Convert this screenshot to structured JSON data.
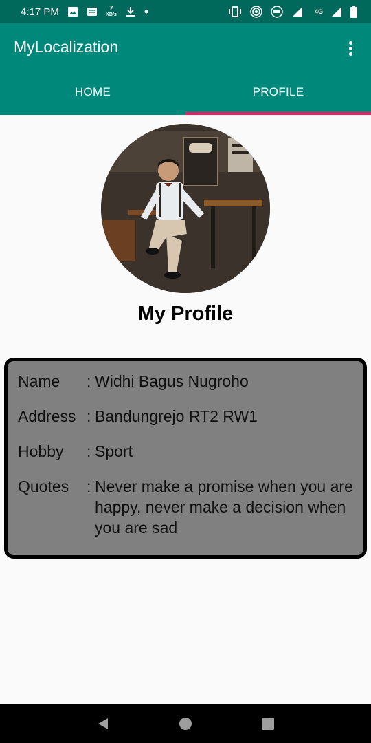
{
  "status_bar": {
    "time": "4:17 PM",
    "speed_value": "7",
    "speed_unit": "KB/s",
    "net_label": "4G"
  },
  "app_bar": {
    "title": "MyLocalization",
    "tabs": [
      {
        "label": "HOME",
        "selected": false
      },
      {
        "label": "PROFILE",
        "selected": true
      }
    ],
    "indicator_color": "#e91e63",
    "background": "#00897b"
  },
  "profile": {
    "heading": "My Profile",
    "fields": [
      {
        "label": "Name",
        "separator": ":",
        "value": "Widhi Bagus Nugroho"
      },
      {
        "label": "Address",
        "separator": ":",
        "value": "Bandungrejo RT2 RW1"
      },
      {
        "label": "Hobby",
        "separator": ":",
        "value": "Sport"
      },
      {
        "label": "Quotes",
        "separator": ":",
        "value": "Never make a promise when you are happy, never make a decision when you are sad"
      }
    ]
  },
  "nav_bar": {
    "buttons": [
      "back-icon",
      "home-icon",
      "recents-icon"
    ]
  }
}
